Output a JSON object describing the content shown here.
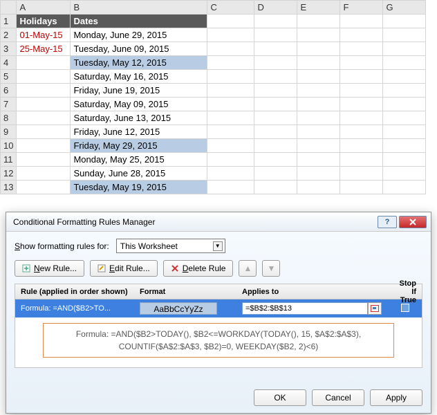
{
  "columns": [
    "A",
    "B",
    "C",
    "D",
    "E",
    "F",
    "G"
  ],
  "headers": {
    "A": "Holidays",
    "B": "Dates"
  },
  "rows": [
    {
      "n": 1,
      "A": "Holidays",
      "B": "Dates",
      "hdr": true
    },
    {
      "n": 2,
      "A": "01-May-15",
      "B": "Monday, June 29, 2015",
      "hol": true
    },
    {
      "n": 3,
      "A": "25-May-15",
      "B": "Tuesday, June 09, 2015",
      "hol": true
    },
    {
      "n": 4,
      "A": "",
      "B": "Tuesday, May 12, 2015",
      "hl": true
    },
    {
      "n": 5,
      "A": "",
      "B": "Saturday, May 16, 2015"
    },
    {
      "n": 6,
      "A": "",
      "B": "Friday, June 19, 2015"
    },
    {
      "n": 7,
      "A": "",
      "B": "Saturday, May 09, 2015"
    },
    {
      "n": 8,
      "A": "",
      "B": "Saturday, June 13, 2015"
    },
    {
      "n": 9,
      "A": "",
      "B": "Friday, June 12, 2015"
    },
    {
      "n": 10,
      "A": "",
      "B": "Friday, May 29, 2015",
      "hl": true
    },
    {
      "n": 11,
      "A": "",
      "B": "Monday, May 25, 2015"
    },
    {
      "n": 12,
      "A": "",
      "B": "Sunday, June 28, 2015"
    },
    {
      "n": 13,
      "A": "",
      "B": "Tuesday, May 19, 2015",
      "hl": true
    }
  ],
  "dialog": {
    "title": "Conditional Formatting Rules Manager",
    "show_label_pref": "S",
    "show_label": "how formatting rules for:",
    "scope": "This Worksheet",
    "buttons": {
      "new_key": "N",
      "new": "ew Rule...",
      "edit_key": "E",
      "edit": "dit Rule...",
      "delete_key": "D",
      "delete": "elete Rule"
    },
    "cols": {
      "rule": "Rule (applied in order shown)",
      "format": "Format",
      "applies": "Applies to",
      "stop": "Stop If True"
    },
    "rule": {
      "label": "Formula: =AND($B2>TO...",
      "format_sample": "AaBbCcYyZz",
      "applies_to": "=$B$2:$B$13"
    },
    "note_l1": "Formula: =AND($B2>TODAY(), $B2<=WORKDAY(TODAY(), 15, $A$2:$A$3),",
    "note_l2": "COUNTIF($A$2:$A$3, $B2)=0, WEEKDAY($B2, 2)<6)",
    "footer": {
      "ok": "OK",
      "cancel": "Cancel",
      "apply": "Apply"
    }
  }
}
